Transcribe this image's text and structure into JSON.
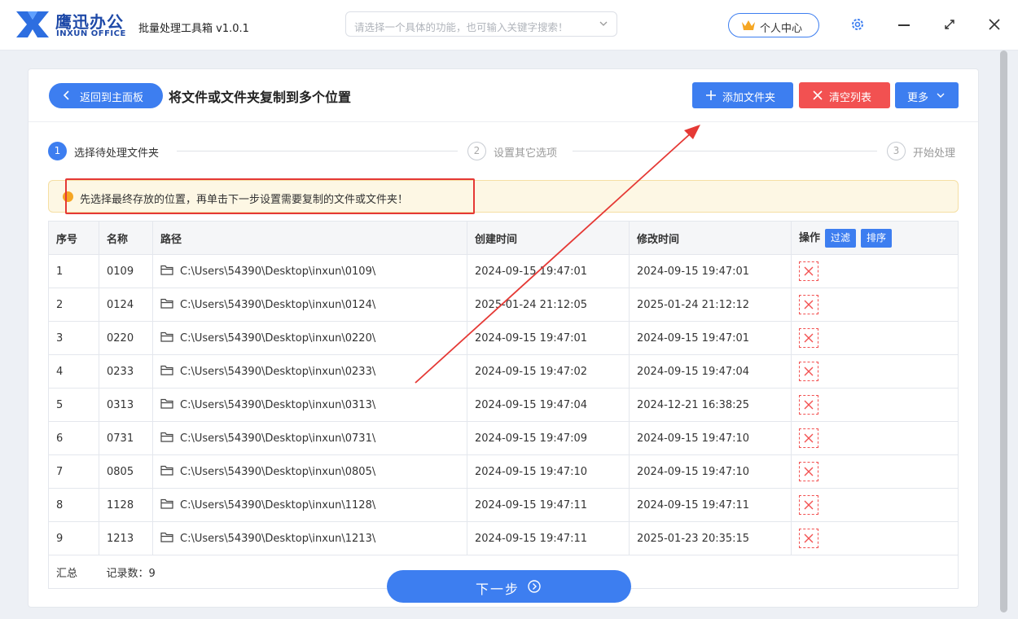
{
  "app": {
    "logo_cn": "鹰迅办公",
    "logo_en": "INXUN OFFICE",
    "title": "批量处理工具箱 v1.0.1",
    "search_placeholder": "请选择一个具体的功能，也可输入关键字搜索！",
    "personal_center": "个人中心"
  },
  "toolbar": {
    "back_label": "返回到主面板",
    "page_title": "将文件或文件夹复制到多个位置",
    "add_folder_label": "添加文件夹",
    "clear_list_label": "清空列表",
    "more_label": "更多"
  },
  "steps": [
    {
      "num": "1",
      "label": "选择待处理文件夹",
      "active": true
    },
    {
      "num": "2",
      "label": "设置其它选项",
      "active": false
    },
    {
      "num": "3",
      "label": "开始处理",
      "active": false
    }
  ],
  "tip": "先选择最终存放的位置，再单击下一步设置需要复制的文件或文件夹！",
  "table": {
    "headers": {
      "index": "序号",
      "name": "名称",
      "path": "路径",
      "created": "创建时间",
      "modified": "修改时间",
      "action": "操作",
      "filter": "过滤",
      "sort": "排序"
    },
    "rows": [
      {
        "index": "1",
        "name": "0109",
        "path": "C:\\Users\\54390\\Desktop\\inxun\\0109\\",
        "created": "2024-09-15 19:47:01",
        "modified": "2024-09-15 19:47:01"
      },
      {
        "index": "2",
        "name": "0124",
        "path": "C:\\Users\\54390\\Desktop\\inxun\\0124\\",
        "created": "2025-01-24 21:12:05",
        "modified": "2025-01-24 21:12:12"
      },
      {
        "index": "3",
        "name": "0220",
        "path": "C:\\Users\\54390\\Desktop\\inxun\\0220\\",
        "created": "2024-09-15 19:47:01",
        "modified": "2024-09-15 19:47:01"
      },
      {
        "index": "4",
        "name": "0233",
        "path": "C:\\Users\\54390\\Desktop\\inxun\\0233\\",
        "created": "2024-09-15 19:47:02",
        "modified": "2024-09-15 19:47:04"
      },
      {
        "index": "5",
        "name": "0313",
        "path": "C:\\Users\\54390\\Desktop\\inxun\\0313\\",
        "created": "2024-09-15 19:47:04",
        "modified": "2024-12-21 16:38:25"
      },
      {
        "index": "6",
        "name": "0731",
        "path": "C:\\Users\\54390\\Desktop\\inxun\\0731\\",
        "created": "2024-09-15 19:47:09",
        "modified": "2024-09-15 19:47:10"
      },
      {
        "index": "7",
        "name": "0805",
        "path": "C:\\Users\\54390\\Desktop\\inxun\\0805\\",
        "created": "2024-09-15 19:47:10",
        "modified": "2024-09-15 19:47:10"
      },
      {
        "index": "8",
        "name": "1128",
        "path": "C:\\Users\\54390\\Desktop\\inxun\\1128\\",
        "created": "2024-09-15 19:47:11",
        "modified": "2024-09-15 19:47:11"
      },
      {
        "index": "9",
        "name": "1213",
        "path": "C:\\Users\\54390\\Desktop\\inxun\\1213\\",
        "created": "2024-09-15 19:47:11",
        "modified": "2025-01-23 20:35:15"
      }
    ],
    "summary_label": "汇总",
    "record_count": "记录数：9"
  },
  "next_label": "下一步",
  "colors": {
    "accent": "#3d7ef0",
    "danger": "#f25151",
    "annotation": "#e53935"
  }
}
